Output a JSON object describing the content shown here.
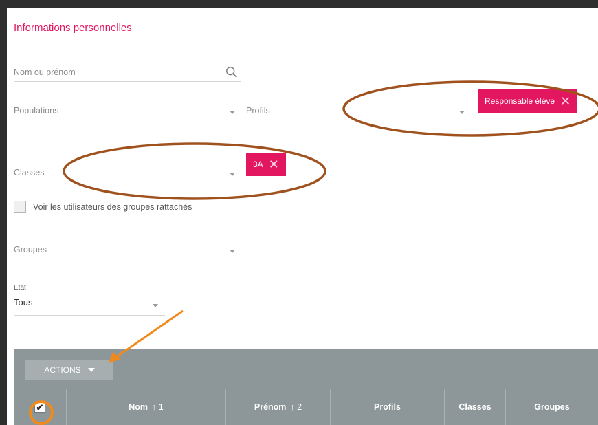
{
  "section_title": "Informations personnelles",
  "search": {
    "placeholder": "Nom ou prénom",
    "icon": "search-icon"
  },
  "filters": {
    "populations": "Populations",
    "profils": "Profils",
    "classes": "Classes",
    "groupes": "Groupes"
  },
  "chips": {
    "profil": "Responsable élève",
    "classe": "3A"
  },
  "checkbox_label": "Voir les utilisateurs des groupes rattachés",
  "etat": {
    "label": "Etat",
    "value": "Tous"
  },
  "table": {
    "actions_label": "ACTIONS",
    "columns": [
      {
        "label": "Nom",
        "sort": "↑ 1"
      },
      {
        "label": "Prénom",
        "sort": "↑ 2"
      },
      {
        "label": "Profils",
        "sort": ""
      },
      {
        "label": "Classes",
        "sort": ""
      },
      {
        "label": "Groupes",
        "sort": ""
      }
    ],
    "select_all_checked": "✔"
  },
  "colors": {
    "accent": "#e3175f",
    "annotation_brown": "#a0521e",
    "annotation_orange": "#f08a1c",
    "table_header": "#8d9799"
  }
}
